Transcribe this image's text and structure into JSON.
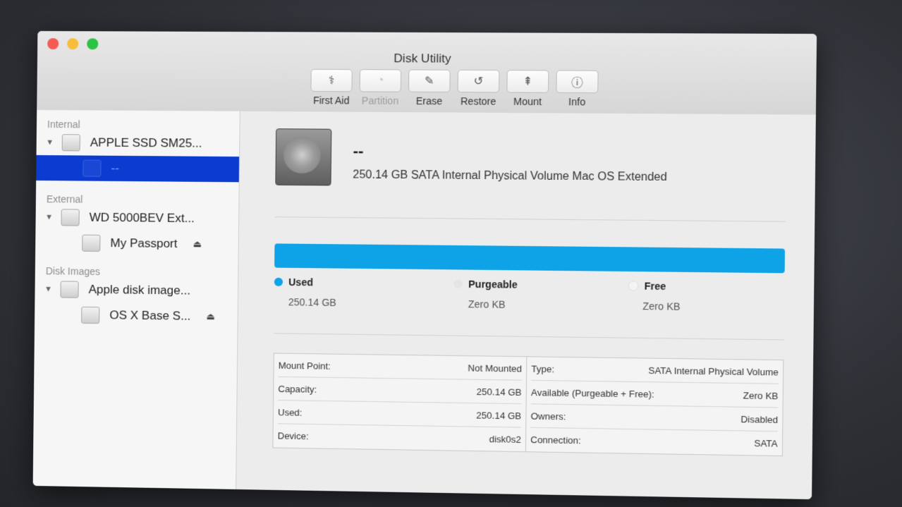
{
  "window": {
    "title": "Disk Utility"
  },
  "toolbar": [
    {
      "label": "First Aid",
      "icon": "stethoscope-icon",
      "glyph": "⚕",
      "disabled": false
    },
    {
      "label": "Partition",
      "icon": "pie-chart-icon",
      "glyph": "◔",
      "disabled": true
    },
    {
      "label": "Erase",
      "icon": "erase-icon",
      "glyph": "✎",
      "disabled": false
    },
    {
      "label": "Restore",
      "icon": "restore-icon",
      "glyph": "↺",
      "disabled": false
    },
    {
      "label": "Mount",
      "icon": "mount-icon",
      "glyph": "⇞",
      "disabled": false
    },
    {
      "label": "Info",
      "icon": "info-icon",
      "glyph": "ⓘ",
      "disabled": false
    }
  ],
  "sidebar": {
    "internal_label": "Internal",
    "internal_disk": "APPLE SSD SM25...",
    "internal_volume": "--",
    "external_label": "External",
    "external_disk": "WD 5000BEV Ext...",
    "external_volume": "My Passport",
    "images_label": "Disk Images",
    "image_disk": "Apple disk image...",
    "image_volume": "OS X Base S..."
  },
  "volume": {
    "name": "--",
    "description": "250.14 GB SATA Internal Physical Volume Mac OS Extended"
  },
  "usage": {
    "used_label": "Used",
    "used_value": "250.14 GB",
    "used_color": "#0ea3e6",
    "purgeable_label": "Purgeable",
    "purgeable_value": "Zero KB",
    "free_label": "Free",
    "free_value": "Zero KB",
    "used_fraction": 1.0
  },
  "info": {
    "left": [
      {
        "label": "Mount Point:",
        "value": "Not Mounted"
      },
      {
        "label": "Capacity:",
        "value": "250.14 GB"
      },
      {
        "label": "Used:",
        "value": "250.14 GB"
      },
      {
        "label": "Device:",
        "value": "disk0s2"
      }
    ],
    "right": [
      {
        "label": "Type:",
        "value": "SATA Internal Physical Volume"
      },
      {
        "label": "Available (Purgeable + Free):",
        "value": "Zero KB"
      },
      {
        "label": "Owners:",
        "value": "Disabled"
      },
      {
        "label": "Connection:",
        "value": "SATA"
      }
    ]
  }
}
